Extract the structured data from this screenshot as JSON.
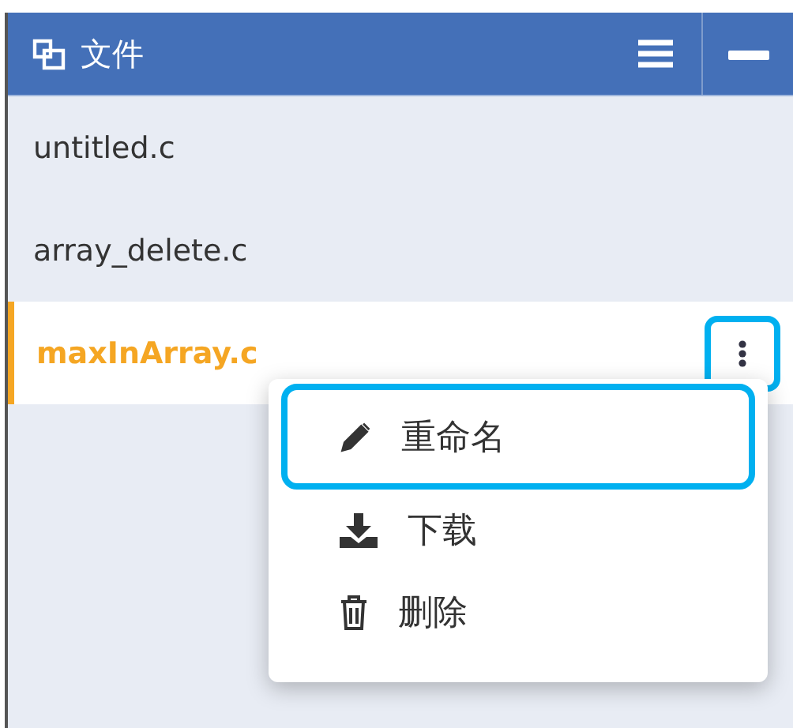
{
  "panel": {
    "title": "文件"
  },
  "files": [
    {
      "name": "untitled.c",
      "selected": false
    },
    {
      "name": "array_delete.c",
      "selected": false
    },
    {
      "name": "maxInArray.c",
      "selected": true,
      "menu_button_highlighted": true
    }
  ],
  "context_menu": {
    "items": [
      {
        "label": "重命名",
        "kind": "rename",
        "highlighted": true
      },
      {
        "label": "下载",
        "kind": "download",
        "highlighted": false
      },
      {
        "label": "删除",
        "kind": "delete",
        "highlighted": false
      }
    ]
  }
}
